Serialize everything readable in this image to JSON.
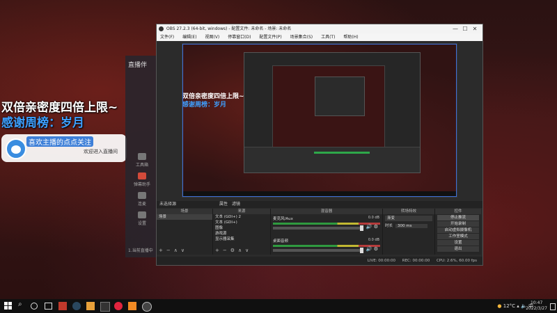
{
  "desktop": {
    "danmaku_line1": "双倍亲密度四倍上限~",
    "danmaku_line2": "感谢周榜：岁月",
    "bubble_title": "喜欢主播的点点关注",
    "bubble_text": "欢迎进入直播间"
  },
  "stream_app": {
    "logo": "直播伴",
    "items": [
      "工具箱",
      "弹幕助手",
      "连麦",
      "设置"
    ],
    "footer": "1.当前直播中"
  },
  "obs": {
    "title": "OBS 27.2.3 (64-bit, windows) - 配置文件: 未命名 - 场景: 未命名",
    "window_buttons": [
      "—",
      "☐",
      "✕"
    ],
    "menu": [
      "文件(F)",
      "编辑(E)",
      "视图(V)",
      "停靠窗口(D)",
      "配置文件(P)",
      "场景集合(S)",
      "工具(T)",
      "帮助(H)"
    ],
    "preview": {
      "text1": "双倍亲密度四倍上限~",
      "text2": "感谢周榜：岁月"
    },
    "controls_row": {
      "label": "未选择源",
      "button1": "属性",
      "button2": "滤镜"
    },
    "scenes": {
      "header": "场景",
      "items": [
        "场景"
      ]
    },
    "sources": {
      "header": "来源",
      "items": [
        "文本 (GDI+) 2",
        "文本 (GDI+)",
        "图像",
        "游戏源",
        "显示器采集"
      ]
    },
    "mixer": {
      "header": "混音器",
      "tracks": [
        {
          "name": "麦克风/Aux",
          "db": "0.0 dB"
        },
        {
          "name": "桌面音频",
          "db": "0.0 dB"
        }
      ]
    },
    "transitions": {
      "header": "转场特效",
      "selected": "渐变",
      "duration_label": "时长",
      "duration_value": "300 ms"
    },
    "controls": {
      "header": "控件",
      "buttons": [
        "停止推流",
        "开始录制",
        "启动虚拟摄像机",
        "工作室模式",
        "设置",
        "退出"
      ]
    },
    "status": {
      "live": "LIVE: 00:00:00",
      "rec": "REC: 00:00:00",
      "cpu": "CPU: 2.6%, 60.00 fps"
    }
  },
  "taskbar": {
    "weather": "12°C",
    "time": "10:47",
    "date": "2022/3/27",
    "lang": "中"
  }
}
